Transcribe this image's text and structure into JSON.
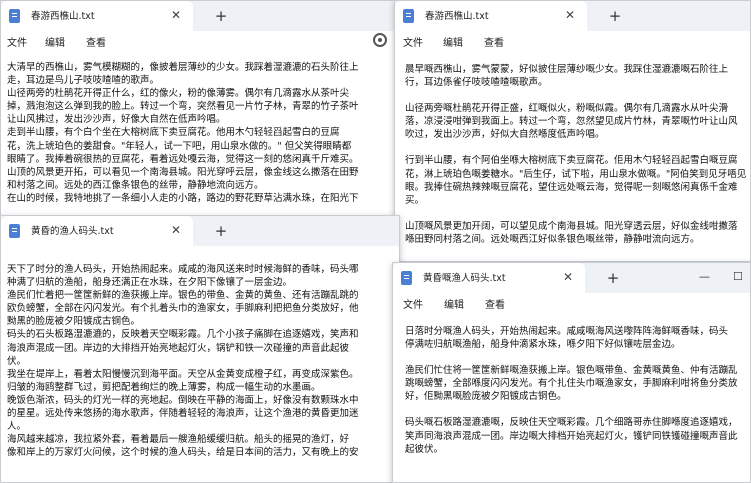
{
  "windows": [
    {
      "tab_title": "春游西樵山.txt",
      "menu": [
        "文件",
        "编辑",
        "查看"
      ],
      "lines": [
        "大清早的西樵山，雾气模糊糊的，像披着层薄纱的少女。我踩着湿漉漉的石头阶往上",
        "走，耳边是鸟儿子吱吱喳喳的歌声。",
        "山径两旁的杜鹃花开得正什么，红的像火，粉的像薄雾。偶尔有几滴露水从茶叶尖",
        "掉，溅泡泡这么弹到我的脸上。转过一个弯，突然看见一片竹子林，青翠的竹子茶叶",
        "让山风拂过，发出沙沙声，好像大自然在低声吟唱。",
        "走到半山腰，有个白个坐在大榕树底下卖豆腐花。他用木勺轻轻舀起雪白的豆腐",
        "花，洗上琥珀色的姜甜食。\"年轻人，试一下吧，用山泉水做的。\" 但父笑得眼睛都",
        "眼睛了。我捧着碗很热的豆腐花，看着远处嘎云海，觉得这一刻的悠闲真千斤难买。",
        "山顶的风景更开拓，可以看见一个南海县城。阳光穿呼云层，像金线这么撒落在田野",
        "和村落之间。远处的西江像条银色的丝带，静静地流向远方。",
        "在山的时候，我特地挑了一条细小人走的小路，路边的野花野草沾满水珠，在阳光下"
      ]
    },
    {
      "tab_title": "春游西樵山.txt",
      "menu": [
        "文件",
        "编辑",
        "查看"
      ],
      "paragraphs": [
        [
          "晨早嘅西樵山，雾气蒙蒙，好似披住层薄纱嘅少女。我踩住湿漉漉嘅石阶往上",
          "行，耳边係雀仔吱吱喳喳嘅歌声。"
        ],
        [
          "山径两旁嘅杜鹃花开得正盛，红嘅似火，粉嘅似霞。偶尔有几滴露水从叶尖滑",
          "落，凉浸浸咁弹到我面上。转过一个弯，忽然望见成片竹林，青翠嘅竹叶让山风",
          "吹过，发出沙沙声，好似大自然喺度低声吟唱。"
        ],
        [
          "行到半山腰，有个阿伯坐喺大榕树底下卖豆腐花。佢用木勺轻轻舀起雪白嘅豆腐",
          "花，淋上琥珀色嘅姜糖水。\"后生仔，试下啦，用山泉水做嘅。\"阿伯笑到见牙唔见",
          "眼。我捧住碗热辣辣嘅豆腐花，望住远处嘅云海，觉得呢一刻嘅悠闲真係千金难",
          "买。"
        ],
        [
          "山顶嘅风景更加开阔，可以望见成个南海县城。阳光穿透云层，好似金线咁撒落",
          "喺田野同村落之间。远处嘅西江好似条银色嘅丝带，静静咁流向远方。"
        ]
      ]
    },
    {
      "tab_title": "黄昏的渔人码头.txt",
      "menu": [
        "文件",
        "编辑",
        "查看"
      ],
      "paragraphs": [
        [
          "天下了时分的渔人码头，开始热闹起来。咸咸的海风送来时时候海鲜的香味，码头哪",
          "种满了归航的渔船，船身还满正在水珠，在夕阳下像镶了一层金边。"
        ],
        [
          "渔民们忙着把一筐筐新鲜的渔获搬上岸。银色的带鱼、金黄的黄鱼、还有活蹦乱跳的",
          "欧负螃蟹，全部在闪闪发光。有个扎着头巾的渔家女，手脚麻利把把鱼分类放好，他",
          "黝黑的脸庞被夕阳镀成古铜色。"
        ],
        [
          "码头的石头板路湿漉漉的，反映着天空嘅彩霞。几个小孩子痛脚在追逐嬉戏，笑声和",
          "海浪声混成一团。岸边的大排挡开始亮地起灯火，锅铲和铁一次碰撞的声音此起彼",
          "伏。"
        ],
        [
          "我坐在堤岸上，看着太阳慢慢沉到海平面。天空从金黄变成橙子红，再变成深紫色。",
          "归皱的海鸥整群飞过，剪把配着绚烂的晚上薄雾，构成一幅生动的水墨画。"
        ],
        [
          "晚饭色渐浓，码头的灯光一样的亮地起。倒映在平静的海面上，好像没有数颗珠水中",
          "的星星。远处传来悠扬的海水歌声，伴随着轻轻的海浪声，让这个渔港的黄昏更加迷",
          "人。"
        ],
        [
          "海风越来越凉，我拉紧外套，看着最后一艘渔船缓缓归航。船头的摇晃的渔灯，好",
          "像和岸上的万家灯火问候，这个时候的渔人码头，给是日本间的活力，又有晚上的安"
        ]
      ]
    },
    {
      "tab_title": "黄昏嘅渔人码头.txt",
      "menu": [
        "文件",
        "编辑",
        "查看"
      ],
      "paragraphs": [
        [
          "日落时分嘅渔人码头，开始热闹起来。咸咸嘅海风送嚟阵阵海鲜嘅香味，码头",
          "停满咗归航嘅渔船，船身仲滴紧水珠，喺夕阳下好似镶咗层金边。"
        ],
        [
          "渔民们忙住将一筐筐新鲜嘅渔获搬上岸。银色嘅带鱼、金黄嘅黄鱼、仲有活蹦乱",
          "跳嘅螃蟹，全部喺度闪闪发光。有个扎住头巾嘅渔家女，手脚麻利咁将鱼分类放",
          "好，佢黝黑嘅脸庞被夕阳镀成古铜色。"
        ],
        [
          "码头嘅石板路湿漉漉嘅，反映住天空嘅彩霞。几个细路哥赤住脚喺度追逐嬉戏，",
          "笑声同海浪声混成一团。岸边嘅大排档开始亮起灯火，镬铲同铁镬碰撞嘅声音此",
          "起彼伏。"
        ]
      ]
    }
  ]
}
